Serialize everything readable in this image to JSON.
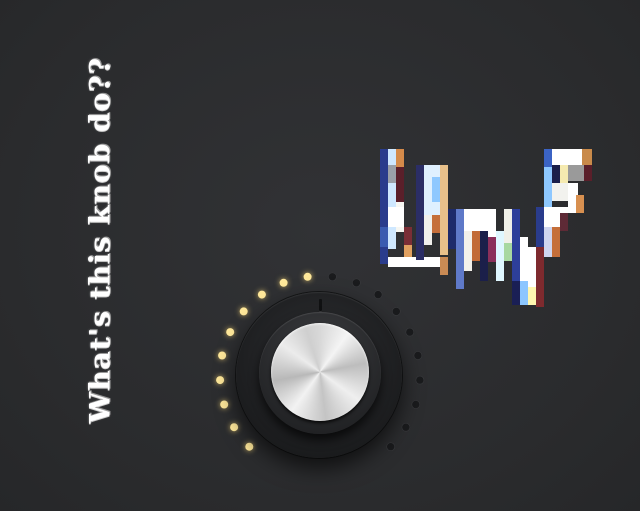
{
  "page": {
    "side_title": "What's this knob do??"
  },
  "knob": {
    "level_percent": 50,
    "total_dots": 20,
    "lit_dots": 10,
    "colors": {
      "lit": "#ffe89a",
      "unlit": "#1a1b1d",
      "background": "#2c2d2f"
    }
  },
  "icons": {
    "logo": "pixel-wave-logo",
    "knob": "rotary-knob"
  }
}
